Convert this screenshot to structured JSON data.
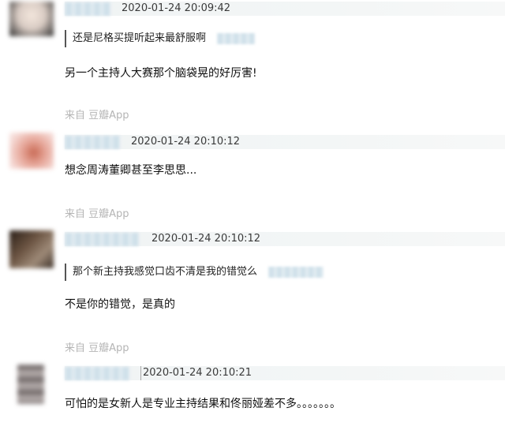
{
  "comments": [
    {
      "time": "2020-01-24 20:09:42",
      "quote": "还是尼格买提听起来最舒服啊",
      "content": "另一个主持人大赛那个脑袋晃的好厉害!",
      "source": "来自 豆瓣App"
    },
    {
      "time": "2020-01-24 20:10:12",
      "content": "想念周涛董卿甚至李思思...",
      "source": "来自 豆瓣App"
    },
    {
      "time": "2020-01-24 20:10:12",
      "quote": "那个新主持我感觉口齿不清是我的错觉么",
      "content": "不是你的错觉，是真的",
      "source": "来自 豆瓣App"
    },
    {
      "time": "2020-01-24 20:10:21",
      "content": "可怕的是女新人是专业主持结果和佟丽娅差不多。。。。。。。"
    }
  ],
  "avatar_colors": [
    "#e3ddd8",
    "#e9b9b2",
    "#5a4636",
    "#8a7f7c"
  ]
}
